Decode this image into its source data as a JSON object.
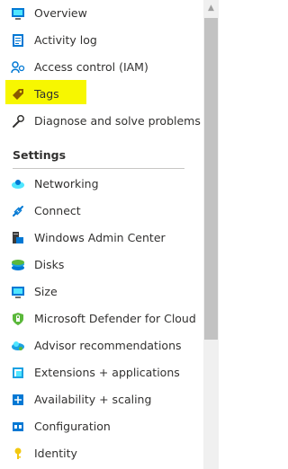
{
  "menu": {
    "items_top": [
      {
        "label": "Overview",
        "icon": "overview-icon"
      },
      {
        "label": "Activity log",
        "icon": "activity-log-icon"
      },
      {
        "label": "Access control (IAM)",
        "icon": "access-control-icon"
      },
      {
        "label": "Tags",
        "icon": "tag-icon",
        "selected": true,
        "highlighted": true
      },
      {
        "label": "Diagnose and solve problems",
        "icon": "wrench-icon"
      }
    ],
    "settings_title": "Settings",
    "items_settings": [
      {
        "label": "Networking",
        "icon": "networking-icon"
      },
      {
        "label": "Connect",
        "icon": "connect-icon"
      },
      {
        "label": "Windows Admin Center",
        "icon": "windows-admin-center-icon"
      },
      {
        "label": "Disks",
        "icon": "disks-icon"
      },
      {
        "label": "Size",
        "icon": "size-icon"
      },
      {
        "label": "Microsoft Defender for Cloud",
        "icon": "defender-shield-icon"
      },
      {
        "label": "Advisor recommendations",
        "icon": "advisor-cloud-icon"
      },
      {
        "label": "Extensions + applications",
        "icon": "extensions-icon"
      },
      {
        "label": "Availability + scaling",
        "icon": "availability-icon"
      },
      {
        "label": "Configuration",
        "icon": "configuration-icon"
      },
      {
        "label": "Identity",
        "icon": "identity-key-icon"
      }
    ]
  },
  "colors": {
    "highlight": "#f7f700",
    "selected_bg": "#edebe9",
    "azure_blue": "#0078d4"
  }
}
